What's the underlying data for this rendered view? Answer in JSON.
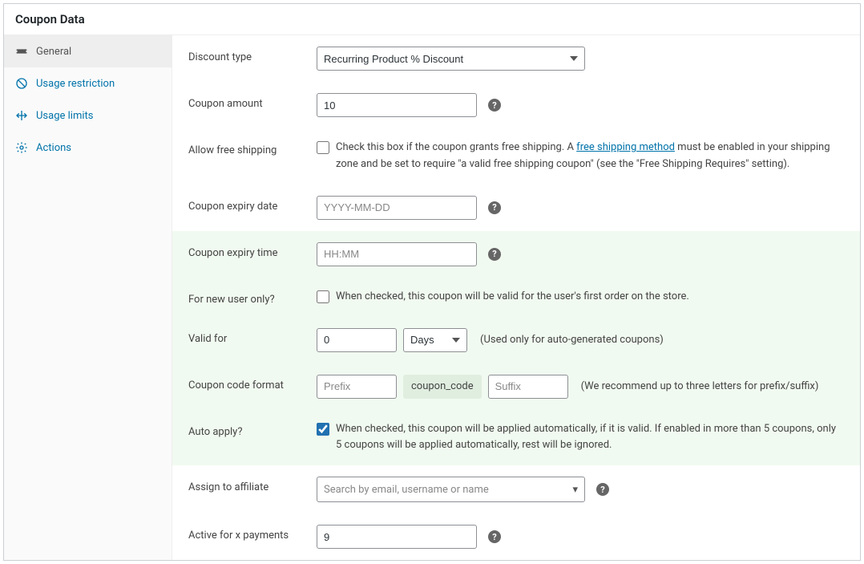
{
  "header": {
    "title": "Coupon Data"
  },
  "sidebar": {
    "items": [
      {
        "label": "General"
      },
      {
        "label": "Usage restriction"
      },
      {
        "label": "Usage limits"
      },
      {
        "label": "Actions"
      }
    ]
  },
  "form": {
    "discount_type": {
      "label": "Discount type",
      "value": "Recurring Product % Discount"
    },
    "coupon_amount": {
      "label": "Coupon amount",
      "value": "10"
    },
    "free_shipping": {
      "label": "Allow free shipping",
      "text_before": "Check this box if the coupon grants free shipping. A ",
      "link": "free shipping method",
      "text_after": " must be enabled in your shipping zone and be set to require \"a valid free shipping coupon\" (see the \"Free Shipping Requires\" setting)."
    },
    "expiry_date": {
      "label": "Coupon expiry date",
      "placeholder": "YYYY-MM-DD"
    },
    "expiry_time": {
      "label": "Coupon expiry time",
      "placeholder": "HH:MM"
    },
    "new_user": {
      "label": "For new user only?",
      "text": "When checked, this coupon will be valid for the user's first order on the store."
    },
    "valid_for": {
      "label": "Valid for",
      "value": "0",
      "unit": "Days",
      "hint": "(Used only for auto-generated coupons)"
    },
    "code_format": {
      "label": "Coupon code format",
      "prefix_placeholder": "Prefix",
      "code_text": "coupon_code",
      "suffix_placeholder": "Suffix",
      "hint": "(We recommend up to three letters for prefix/suffix)"
    },
    "auto_apply": {
      "label": "Auto apply?",
      "text": "When checked, this coupon will be applied automatically, if it is valid. If enabled in more than 5 coupons, only 5 coupons will be applied automatically, rest will be ignored."
    },
    "affiliate": {
      "label": "Assign to affiliate",
      "placeholder": "Search by email, username or name"
    },
    "active_payments": {
      "label": "Active for x payments",
      "value": "9"
    }
  }
}
